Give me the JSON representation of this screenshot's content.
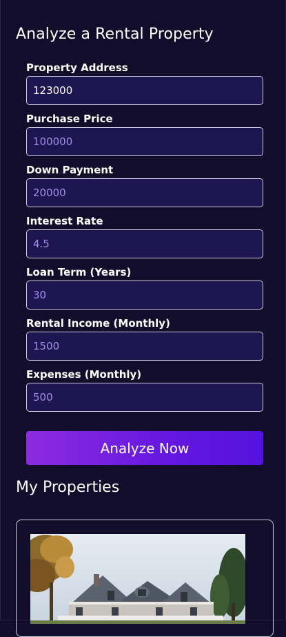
{
  "form": {
    "title": "Analyze a Rental Property",
    "fields": [
      {
        "label": "Property Address",
        "value": "123000",
        "placeholder": ""
      },
      {
        "label": "Purchase Price",
        "value": "",
        "placeholder": "100000"
      },
      {
        "label": "Down Payment",
        "value": "",
        "placeholder": "20000"
      },
      {
        "label": "Interest Rate",
        "value": "",
        "placeholder": "4.5"
      },
      {
        "label": "Loan Term (Years)",
        "value": "",
        "placeholder": "30"
      },
      {
        "label": "Rental Income (Monthly)",
        "value": "",
        "placeholder": "1500"
      },
      {
        "label": "Expenses (Monthly)",
        "value": "",
        "placeholder": "500"
      }
    ],
    "submit_label": "Analyze Now"
  },
  "properties": {
    "title": "My Properties"
  },
  "colors": {
    "background": "#130d2c",
    "input_background": "#1e1650",
    "placeholder": "#9f8fe8",
    "button_gradient_start": "#8d2be0",
    "button_gradient_end": "#5512de"
  }
}
